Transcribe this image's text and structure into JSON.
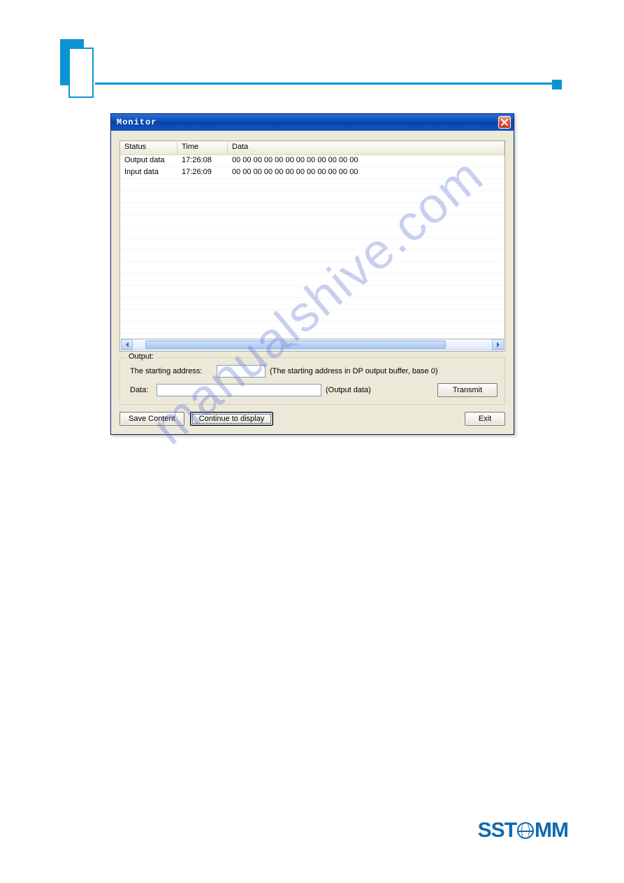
{
  "dialog": {
    "title": "Monitor",
    "table": {
      "headers": [
        "Status",
        "Time",
        "Data"
      ],
      "rows": [
        {
          "status": "Output data",
          "time": "17:26:08",
          "data": "00 00 00 00 00 00 00 00 00 00 00 00"
        },
        {
          "status": "Input data",
          "time": "17:26:09",
          "data": "00 00 00 00 00 00 00 00 00 00 00 00"
        }
      ]
    },
    "output_group": {
      "legend": "Output:",
      "starting_label": "The starting address:",
      "starting_value": "",
      "starting_hint": "(The starting address in DP output buffer, base 0)",
      "data_label": "Data:",
      "data_value": "",
      "data_hint": "(Output data)",
      "transmit_label": "Transmit"
    },
    "buttons": {
      "save": "Save Content",
      "continue": "Continue to display",
      "exit": "Exit"
    }
  },
  "watermark": "manualshive.com",
  "logo": {
    "part1": "SST",
    "part2": "MM"
  }
}
